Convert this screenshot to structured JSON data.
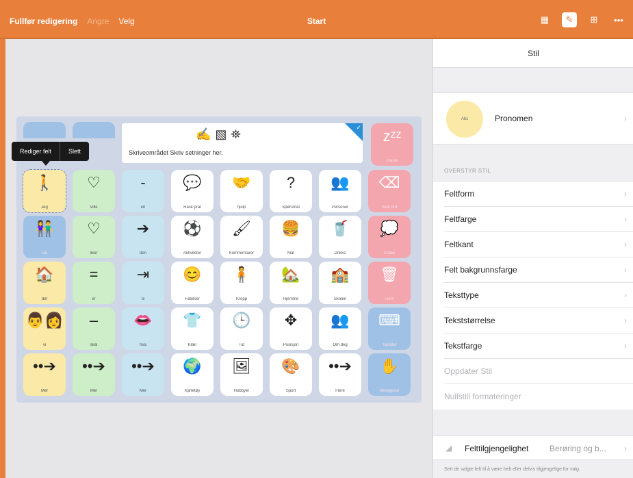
{
  "topbar": {
    "done_label": "Fullfør redigering",
    "undo_label": "Angre",
    "select_label": "Velg",
    "title": "Start",
    "icons": [
      "grid-edit-icon",
      "brush-icon",
      "grid-icon",
      "more-icon"
    ]
  },
  "tooltip": {
    "edit_label": "Rediger felt",
    "delete_label": "Slett"
  },
  "writebar": {
    "text": "Skriveområdet  Skriv setninger her."
  },
  "board": {
    "top_right": {
      "label": "Pause",
      "symbol": "zᶻᶻ"
    },
    "rows": [
      [
        {
          "label": "Jeg",
          "symbol": "🚶",
          "color": "yellow"
        },
        {
          "label": "Ville",
          "symbol": "♡",
          "color": "green"
        },
        {
          "label": "en",
          "symbol": "-",
          "color": "blue"
        },
        {
          "label": "Rask prat",
          "symbol": "💬",
          "color": "white"
        },
        {
          "label": "hjelp",
          "symbol": "🤝",
          "color": "white"
        },
        {
          "label": "Spørsmål",
          "symbol": "?",
          "color": "white"
        },
        {
          "label": "Personer",
          "symbol": "👥",
          "color": "white"
        },
        {
          "label": "Slett ord",
          "symbol": "⌫",
          "color": "red"
        }
      ],
      [
        {
          "label": "Du",
          "symbol": "👫",
          "color": "steel"
        },
        {
          "label": "liker",
          "symbol": "♡",
          "color": "green"
        },
        {
          "label": "den",
          "symbol": "➔",
          "color": "blue"
        },
        {
          "label": "Aktiviteter",
          "symbol": "⚽",
          "color": "white"
        },
        {
          "label": "Kommentarer",
          "symbol": "🖌",
          "color": "white"
        },
        {
          "label": "Mat",
          "symbol": "🍔",
          "color": "white"
        },
        {
          "label": "Drikke",
          "symbol": "🥤",
          "color": "white"
        },
        {
          "label": "Snakk",
          "symbol": "💭",
          "color": "red"
        }
      ],
      [
        {
          "label": "det",
          "symbol": "🏠",
          "color": "yellow"
        },
        {
          "label": "er",
          "symbol": "=",
          "color": "green"
        },
        {
          "label": "til",
          "symbol": "⇥",
          "color": "blue"
        },
        {
          "label": "Følelser",
          "symbol": "😊",
          "color": "white"
        },
        {
          "label": "Kropp",
          "symbol": "🧍",
          "color": "white"
        },
        {
          "label": "Hjemme",
          "symbol": "🏡",
          "color": "white"
        },
        {
          "label": "Skolen",
          "symbol": "🏫",
          "color": "white"
        },
        {
          "label": "Fjern",
          "symbol": "🗑",
          "color": "red"
        }
      ],
      [
        {
          "label": "vi",
          "symbol": "👨‍👩",
          "color": "yellow"
        },
        {
          "label": "skal",
          "symbol": "–",
          "color": "green"
        },
        {
          "label": "hva",
          "symbol": "👄",
          "color": "blue"
        },
        {
          "label": "Klær",
          "symbol": "👕",
          "color": "white"
        },
        {
          "label": "Tid",
          "symbol": "🕒",
          "color": "white"
        },
        {
          "label": "Posisjon",
          "symbol": "✥",
          "color": "white"
        },
        {
          "label": "Om deg",
          "symbol": "👥",
          "color": "white"
        },
        {
          "label": "Tastatur",
          "symbol": "⌨",
          "color": "steel"
        }
      ],
      [
        {
          "label": "Mer",
          "symbol": "••➔",
          "color": "yellow"
        },
        {
          "label": "Mer",
          "symbol": "••➔",
          "color": "green"
        },
        {
          "label": "Mer",
          "symbol": "••➔",
          "color": "blue"
        },
        {
          "label": "Kjøretøy",
          "symbol": "🌍",
          "color": "white"
        },
        {
          "label": "Hobbyer",
          "symbol": "🖼",
          "color": "white"
        },
        {
          "label": "Sport",
          "symbol": "🎨",
          "color": "white"
        },
        {
          "label": "Flere",
          "symbol": "••➔",
          "color": "white"
        },
        {
          "label": "Bevegelse",
          "symbol": "✋",
          "color": "steel"
        }
      ]
    ]
  },
  "panel": {
    "header": "Stil",
    "style_name": "Pronomen",
    "style_swatch_text": "Abc",
    "section_label": "OVERSTYR STIL",
    "rows": [
      {
        "label": "Feltform",
        "enabled": true
      },
      {
        "label": "Feltfarge",
        "enabled": true
      },
      {
        "label": "Feltkant",
        "enabled": true
      },
      {
        "label": "Felt bakgrunnsfarge",
        "enabled": true
      },
      {
        "label": "Teksttype",
        "enabled": true
      },
      {
        "label": "Tekststørrelse",
        "enabled": true
      },
      {
        "label": "Tekstfarge",
        "enabled": true
      },
      {
        "label": "Oppdater Stil",
        "enabled": false
      },
      {
        "label": "Nullstill formateringer",
        "enabled": false
      }
    ],
    "access_label": "Felttilgjengelighet",
    "access_value": "Berøring og b...",
    "hint": "Sett de valgte felt til å være helt eller delvis tilgjengelige for valg."
  },
  "colors": {
    "accent": "#e8803c",
    "yellow": "#fbe9a7",
    "green": "#cdeec8",
    "blue": "#c8e4f1",
    "white": "#ffffff",
    "red": "#f3a6ad",
    "steel": "#9fc1e5"
  }
}
